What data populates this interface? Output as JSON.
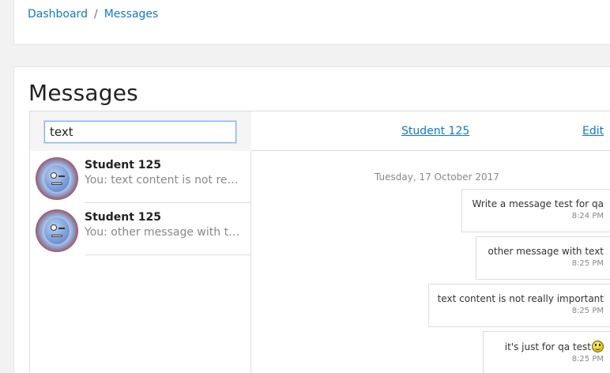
{
  "breadcrumb": {
    "items": [
      "Dashboard",
      "Messages"
    ],
    "separator": "/"
  },
  "page": {
    "title": "Messages"
  },
  "search": {
    "value": "text",
    "placeholder": ""
  },
  "conversations": [
    {
      "name": "Student 125",
      "preview": "You: text content is not really important"
    },
    {
      "name": "Student 125",
      "preview": "You: other message with text"
    }
  ],
  "chat": {
    "contact_name": "Student 125",
    "edit_label": "Edit",
    "date": "Tuesday, 17 October 2017",
    "messages": [
      {
        "text": "Write a message test for qa",
        "time": "8:24 PM"
      },
      {
        "text": "other message with text",
        "time": "8:25 PM"
      },
      {
        "text": "text content is not really important",
        "time": "8:25 PM"
      },
      {
        "text": "it's just for qa test",
        "time": "8:25 PM",
        "emoji": "smiley-icon"
      }
    ]
  },
  "colors": {
    "link": "#1177d1",
    "muted": "#888888",
    "border": "#dddddd",
    "focus": "#7aaef0"
  }
}
